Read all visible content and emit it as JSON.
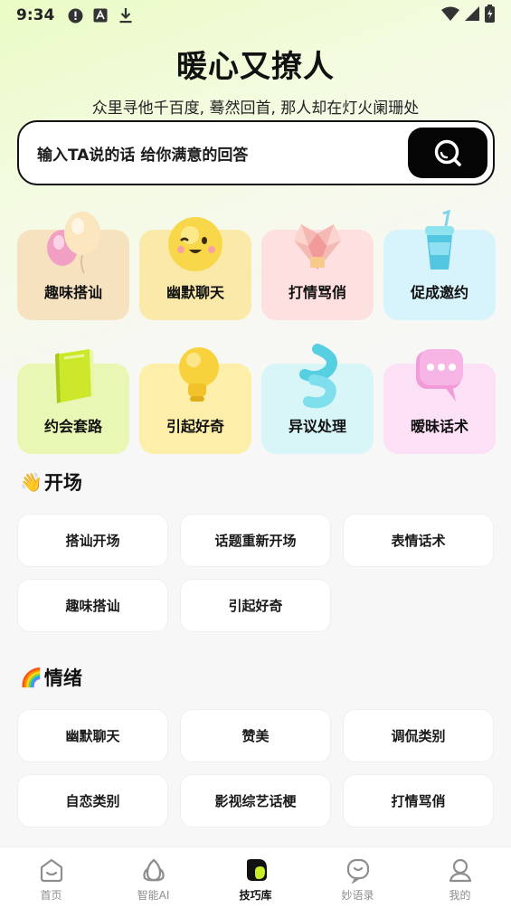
{
  "status": {
    "time": "9:34"
  },
  "hero": {
    "title": "暖心又撩人",
    "subtitle": "众里寻他千百度, 蓦然回首, 那人却在灯火阑珊处"
  },
  "search": {
    "placeholder": "输入TA说的话 给你满意的回答"
  },
  "categories": [
    {
      "label": "趣味搭讪",
      "color": "#f7e2c0",
      "icon": "balloon-icon"
    },
    {
      "label": "幽默聊天",
      "color": "#fbe9a9",
      "icon": "smiley-icon"
    },
    {
      "label": "打情骂俏",
      "color": "#fde0df",
      "icon": "gem-heart-icon"
    },
    {
      "label": "促成邀约",
      "color": "#d7f3fb",
      "icon": "cup-icon"
    },
    {
      "label": "约会套路",
      "color": "#e9f7b5",
      "icon": "book-icon"
    },
    {
      "label": "引起好奇",
      "color": "#fdeea9",
      "icon": "bulb-icon"
    },
    {
      "label": "异议处理",
      "color": "#d8f6f8",
      "icon": "wave-icon"
    },
    {
      "label": "暧昧话术",
      "color": "#fbe0f6",
      "icon": "chat-bubble-icon"
    }
  ],
  "sections": [
    {
      "emoji": "👋",
      "title": "开场",
      "tags": [
        "搭讪开场",
        "话题重新开场",
        "表情话术",
        "趣味搭讪",
        "引起好奇"
      ]
    },
    {
      "emoji": "🌈",
      "title": "情绪",
      "tags": [
        "幽默聊天",
        "赞美",
        "调侃类别",
        "自恋类别",
        "影视综艺话梗",
        "打情骂俏"
      ]
    }
  ],
  "nav": [
    {
      "label": "首页",
      "icon": "home-icon",
      "active": false
    },
    {
      "label": "智能AI",
      "icon": "ai-icon",
      "active": false
    },
    {
      "label": "技巧库",
      "icon": "library-icon",
      "active": true
    },
    {
      "label": "妙语录",
      "icon": "quotes-icon",
      "active": false
    },
    {
      "label": "我的",
      "icon": "profile-icon",
      "active": false
    }
  ]
}
